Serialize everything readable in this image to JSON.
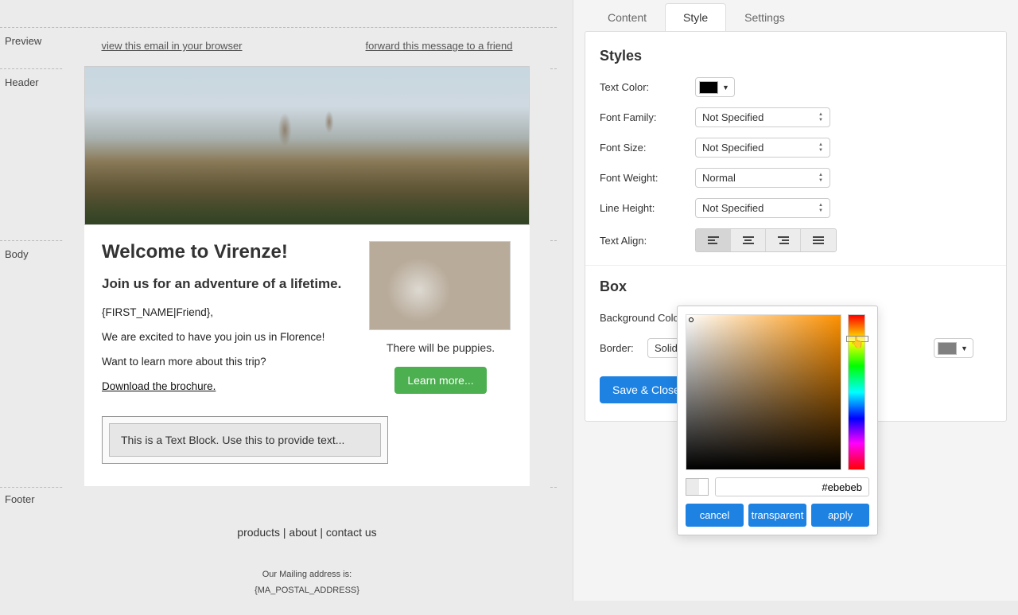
{
  "sections": {
    "preview": "Preview",
    "header": "Header",
    "body": "Body",
    "footer": "Footer"
  },
  "preview_bar": {
    "view_browser": "view this email in your browser",
    "forward": "forward this message to a friend"
  },
  "email": {
    "h1": "Welcome to Virenze!",
    "h2": "Join us for an adventure of a lifetime.",
    "p1": "{FIRST_NAME|Friend},",
    "p2": "We are excited to have you join us in Florence!",
    "p3": "Want to learn more about this trip?",
    "brochure": "Download the brochure.",
    "text_block": "This is a Text Block. Use this to provide text...",
    "side_caption": "There will be puppies.",
    "learn_btn": "Learn more..."
  },
  "footer": {
    "links": "products | about | contact us",
    "mail_label": "Our Mailing address is:",
    "mail_token": "{MA_POSTAL_ADDRESS}"
  },
  "tabs": {
    "content": "Content",
    "style": "Style",
    "settings": "Settings"
  },
  "styles_panel": {
    "heading": "Styles",
    "text_color_label": "Text Color:",
    "text_color_value": "#000000",
    "font_family_label": "Font Family:",
    "font_family_value": "Not Specified",
    "font_size_label": "Font Size:",
    "font_size_value": "Not Specified",
    "font_weight_label": "Font Weight:",
    "font_weight_value": "Normal",
    "line_height_label": "Line Height:",
    "line_height_value": "Not Specified",
    "text_align_label": "Text Align:"
  },
  "box_panel": {
    "heading": "Box",
    "bg_color_label": "Background Color:",
    "bg_color_value": "#ebebeb",
    "border_label": "Border:",
    "border_style": "Solid",
    "border_color_value": "#808080",
    "save_close": "Save & Close"
  },
  "color_picker": {
    "hex": "#ebebeb",
    "cancel": "cancel",
    "transparent": "transparent",
    "apply": "apply"
  }
}
